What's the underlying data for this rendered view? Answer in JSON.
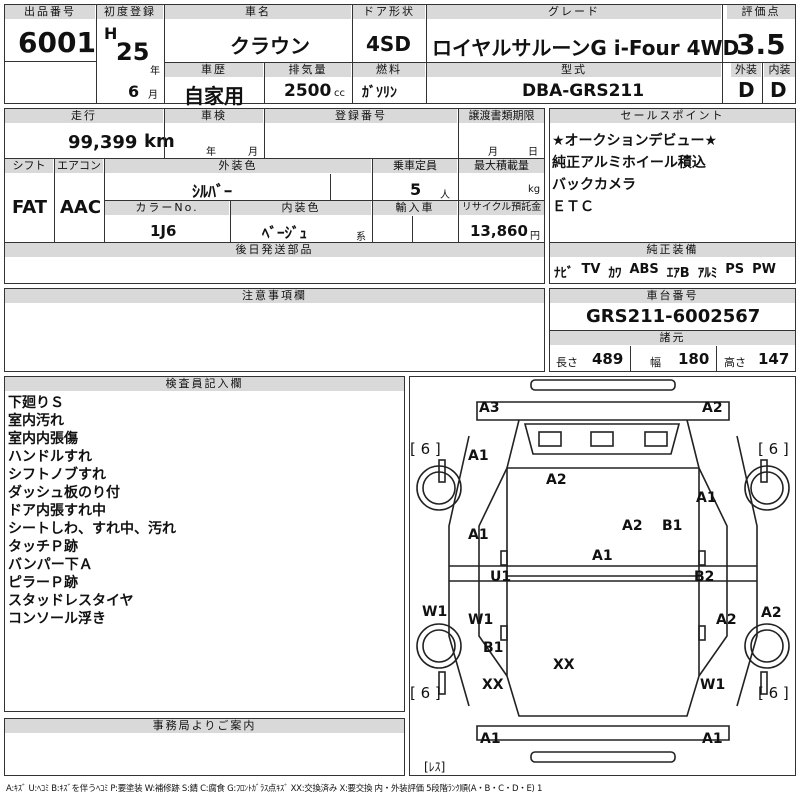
{
  "header": {
    "lot_label": "出品番号",
    "lot": "6001",
    "reg_label": "初度登録",
    "era": "H",
    "year": "25",
    "year_unit": "年",
    "month": "6",
    "month_unit": "月",
    "name_label": "車名",
    "name": "クラウン",
    "door_label": "ドア形状",
    "door": "4SD",
    "grade_label": "グレード",
    "grade": "ロイヤルサルーンG i-Four 4WD",
    "score_label": "評価点",
    "score": "3.5",
    "ext_label": "外装",
    "ext": "D",
    "int_label": "内装",
    "int": "D",
    "history_label": "車歴",
    "history": "自家用",
    "disp_label": "排気量",
    "disp": "2500",
    "disp_unit": "cc",
    "fuel_label": "燃料",
    "fuel": "ｶﾞｿﾘﾝ",
    "model_label": "型式",
    "model": "DBA-GRS211"
  },
  "row2": {
    "mileage_label": "走行",
    "mileage": "99,399",
    "mileage_unit": "km",
    "inspect_label": "車検",
    "inspect_year": "年",
    "inspect_month": "月",
    "plate_label": "登録番号",
    "transfer_label": "譲渡書類期限",
    "transfer_month": "月",
    "transfer_day": "日",
    "shift_label": "シフト",
    "shift": "FAT",
    "ac_label": "エアコン",
    "ac": "AAC",
    "color_label": "外装色",
    "color": "ｼﾙﾊﾞｰ",
    "cap_label": "乗車定員",
    "cap": "5",
    "cap_unit": "人",
    "load_label": "最大積載量",
    "load_unit": "kg",
    "colorno_label": "カラーNo.",
    "colorno": "1J6",
    "intcolor_label": "内装色",
    "intcolor": "ﾍﾞｰｼﾞｭ",
    "intcolor_unit": "系",
    "import_label": "輸入車",
    "recycle_label": "リサイクル預託金",
    "recycle": "13,860",
    "recycle_unit": "円",
    "parts_label": "後日発送部品"
  },
  "sales": {
    "label": "セールスポイント",
    "lines": [
      "★オークションデビュー★",
      "純正アルミホイール積込",
      "バックカメラ",
      "ＥＴＣ"
    ]
  },
  "equip": {
    "label": "純正装備",
    "items": [
      "ﾅﾋﾞ",
      "TV",
      "ｶﾜ",
      "ABS",
      "ｴｱB",
      "ｱﾙﾐ",
      "PS",
      "PW"
    ]
  },
  "notes": {
    "label": "注意事項欄"
  },
  "chassis": {
    "label": "車台番号",
    "value": "GRS211-6002567"
  },
  "dims": {
    "label": "諸元",
    "length_label": "長さ",
    "length": "489",
    "width_label": "幅",
    "width": "180",
    "height_label": "高さ",
    "height": "147"
  },
  "inspector": {
    "label": "検査員記入欄",
    "lines": [
      "下廻りＳ",
      "室内汚れ",
      "室内内張傷",
      "ハンドルすれ",
      "シフトノブすれ",
      "ダッシュ板のり付",
      "ドア内張すれ中",
      "シートしわ、すれ中、汚れ",
      "タッチＰ跡",
      "バンパー下Ａ",
      "ピラーＰ跡",
      "スタッドレスタイヤ",
      "コンソール浮き"
    ]
  },
  "office": {
    "label": "事務局よりご案内"
  },
  "diagram": {
    "marks": [
      "A3",
      "A2",
      "A1",
      "A2",
      "A1",
      "A1",
      "A2",
      "B1",
      "A1",
      "U1",
      "B2",
      "W1",
      "W1",
      "A2",
      "A2",
      "B1",
      "XX",
      "XX",
      "W1",
      "A1",
      "A1"
    ],
    "tire_labels": [
      "[ 6 ]",
      "[ 6 ]",
      "[ 6 ]",
      "[ 6 ]"
    ],
    "rear_label": "[ﾚｽ]"
  },
  "legend": "A:ｷｽﾞ U:ﾍｺﾐ B:ｷｽﾞを伴うﾍｺﾐ P:要塗装 W:補修跡 S:錆 C:腐食 G:ﾌﾛﾝﾄｶﾞﾗｽ点ｷｽﾞ XX:交換済み X:要交換 内・外装評価 5段階ﾗﾝｸ順(A・B・C・D・E) 1"
}
